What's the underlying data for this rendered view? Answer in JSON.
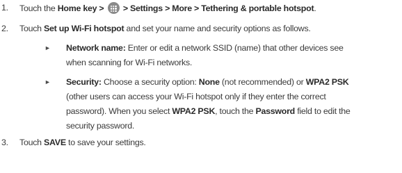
{
  "steps": [
    {
      "number": "1.",
      "line1": {
        "a": "Touch the ",
        "b": "Home",
        "c": " key > ",
        "d": " > Settings > More > Tethering & portable hotspot",
        "e": "."
      }
    },
    {
      "number": "2.",
      "line1": {
        "a": "Touch ",
        "b": "Set up Wi-Fi hotspot",
        "c": " and set your name and security options as follows."
      }
    },
    {
      "number": "3.",
      "line1": {
        "a": "Touch ",
        "b": "SAVE",
        "c": " to save your settings."
      }
    }
  ],
  "bullets": [
    {
      "symbol": "►",
      "l1": {
        "b": "Network name:",
        "c": " Enter or edit a network SSID (name) that other devices see"
      },
      "l2": "when scanning for Wi-Fi networks."
    },
    {
      "symbol": "►",
      "l1": {
        "b": "Security:",
        "c": " Choose a security option: ",
        "d": "None",
        "e": " (not recommended) or ",
        "f": "WPA2 PSK"
      },
      "l2": "(other users can access your Wi-Fi hotspot only if they enter the correct",
      "l3": {
        "a": "password). When you select ",
        "b": "WPA2 PSK",
        "c": ", touch the ",
        "d": "Password",
        "e": " field to edit the"
      },
      "l4": "security password."
    }
  ],
  "icons": {
    "apps": "apps-grid-icon",
    "bullet": "triangle-bullet-icon"
  }
}
